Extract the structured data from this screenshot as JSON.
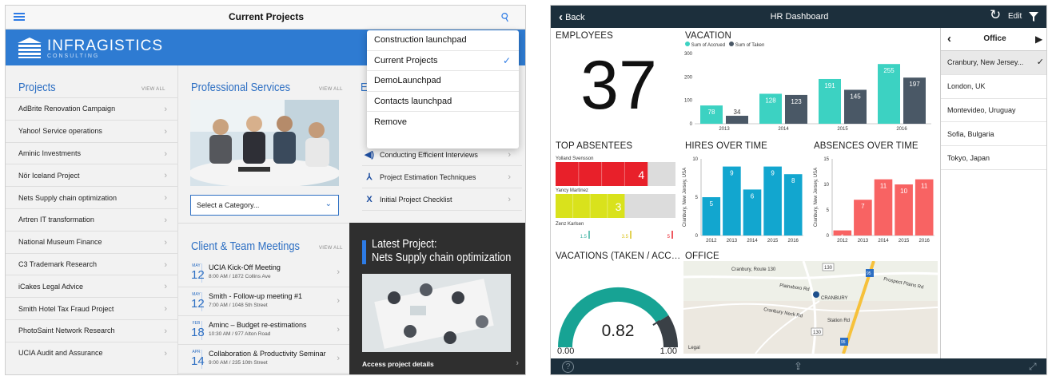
{
  "left_app": {
    "title": "Current Projects",
    "brand": {
      "name": "INFRAGISTICS",
      "sub": "CONSULTING"
    },
    "projects": {
      "heading": "Projects",
      "view_all": "VIEW ALL",
      "items": [
        "AdBrite Renovation Campaign",
        "Yahoo! Service operations",
        "Aminic Investments",
        "Nör Iceland Project",
        "Nets Supply chain optimization",
        "Artren IT transformation",
        "National Museum Finance",
        "C3 Trademark Research",
        "iCakes Legal Advice",
        "Smith Hotel Tax Fraud Project",
        "PhotoSaint Network Research",
        "UCIA Audit and Assurance"
      ]
    },
    "professional": {
      "heading": "Professional Services",
      "view_all": "VIEW ALL",
      "select_label": "Select a Category..."
    },
    "articles": {
      "heading_fragment": "E",
      "items": [
        {
          "icon": "audio-icon",
          "glyph": "◀)",
          "label": "Conducting Efficient Interviews"
        },
        {
          "icon": "pdf-icon",
          "glyph": "⅄",
          "label": "Project Estimation Techniques"
        },
        {
          "icon": "excel-icon",
          "glyph": "X",
          "label": "Initial Project Checklist"
        }
      ]
    },
    "meetings": {
      "heading": "Client & Team Meetings",
      "view_all": "VIEW ALL",
      "items": [
        {
          "month": "MAY",
          "day": "12",
          "title": "UCIA Kick-Off Meeting",
          "detail": "8:00 AM / 1872 Collins Ave"
        },
        {
          "month": "MAY",
          "day": "12",
          "title": "Smith - Follow-up meeting #1",
          "detail": "7:00 AM / 1048 5th Street"
        },
        {
          "month": "FEB",
          "day": "18",
          "title": "Aminc – Budget re-estimations",
          "detail": "10:30 AM / 977 Alton Road"
        },
        {
          "month": "APR",
          "day": "14",
          "title": "Collaboration & Productivity Seminar",
          "detail": "9:00 AM / 235 10th Street"
        }
      ]
    },
    "latest": {
      "line1": "Latest Project:",
      "line2": "Nets Supply chain optimization",
      "link": "Access project details"
    },
    "dropdown": {
      "items": [
        "Construction launchpad",
        "Current Projects",
        "DemoLaunchpad",
        "Contacts launchpad",
        "Remove"
      ],
      "selected_index": 1
    }
  },
  "right_app": {
    "back": "Back",
    "title": "HR Dashboard",
    "edit": "Edit",
    "employees": {
      "heading": "EMPLOYEES",
      "value": "37"
    },
    "vacations_gauge": {
      "heading": "VACATIONS (TAKEN / ACC…",
      "value_label": "0.82",
      "value": 0.82,
      "min_label": "0.00",
      "max_label": "1.00"
    },
    "office_map": {
      "heading": "OFFICE",
      "labels": [
        "Cranbury, Route 130",
        "Plainsboro Rd",
        "Prospect Plains Rd",
        "CRANBURY",
        "Cranbury Neck Rd",
        "Station Rd",
        "Legal"
      ],
      "road_numbers": [
        "130",
        "95",
        "130",
        "95"
      ]
    },
    "top_absentees": {
      "heading": "TOP ABSENTEES",
      "people": [
        {
          "name": "Yolland Svensson",
          "value": 4,
          "color": "#e8202a"
        },
        {
          "name": "Yancy Martinez",
          "value": 3,
          "color": "#d9e21c"
        },
        {
          "name": "Zenz Karlsen",
          "value": null,
          "color": "#3ab0a0"
        }
      ],
      "scale": [
        "1.5",
        "3.5",
        "5"
      ]
    },
    "office_list": {
      "heading": "Office",
      "items": [
        "Cranbury, New Jersey...",
        "London, UK",
        "Montevideo, Uruguay",
        "Sofia, Bulgaria",
        "Tokyo, Japan"
      ],
      "selected_index": 0
    }
  },
  "chart_data": [
    {
      "type": "bar",
      "title": "VACATION",
      "categories": [
        "2013",
        "2014",
        "2015",
        "2016"
      ],
      "series": [
        {
          "name": "Sum of Accrued",
          "values": [
            78,
            128,
            191,
            255
          ],
          "color": "#3cd2c2"
        },
        {
          "name": "Sum of Taken",
          "values": [
            34,
            123,
            145,
            197
          ],
          "color": "#4a5866"
        }
      ],
      "ylim": [
        0,
        300
      ],
      "yticks": [
        "0",
        "100",
        "200",
        "300"
      ],
      "legend": "top"
    },
    {
      "type": "bar",
      "title": "HIRES OVER TIME",
      "ylabel": "Cranbury, New Jersey, USA",
      "categories": [
        "2012",
        "2013",
        "2014",
        "2015",
        "2016"
      ],
      "values": [
        5,
        9,
        6,
        9,
        8
      ],
      "color": "#12a6cf",
      "ylim": [
        0,
        10
      ],
      "yticks": [
        "0",
        "5",
        "10"
      ]
    },
    {
      "type": "bar",
      "title": "ABSENCES OVER TIME",
      "ylabel": "Cranbury, New Jersey, USA",
      "categories": [
        "2012",
        "2013",
        "2014",
        "2015",
        "2016"
      ],
      "values": [
        1,
        7,
        11,
        10,
        11
      ],
      "color": "#f86363",
      "ylim": [
        0,
        15
      ],
      "yticks": [
        "0",
        "5",
        "10",
        "15"
      ]
    }
  ]
}
